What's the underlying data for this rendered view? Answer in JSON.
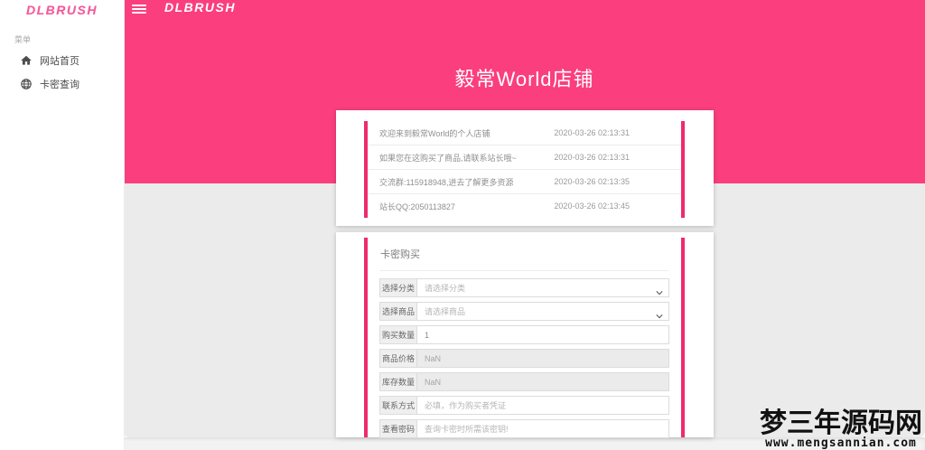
{
  "colors": {
    "accent_pink": "#fb3e7d",
    "border_pink": "#ee2b6e",
    "page_bg": "#ebebeb"
  },
  "sidebar": {
    "logo": "DLBRUSH",
    "menu_label": "菜单",
    "items": [
      {
        "label": "网站首页",
        "icon": "home-icon"
      },
      {
        "label": "卡密查询",
        "icon": "globe-icon"
      }
    ]
  },
  "header": {
    "logo": "DLBRUSH"
  },
  "banner": {
    "title": "毅常World店铺"
  },
  "announcements": {
    "rows": [
      {
        "text": "欢迎来到毅常World的个人店铺",
        "time": "2020-03-26 02:13:31"
      },
      {
        "text": "如果您在这购买了商品,请联系站长哦~",
        "time": "2020-03-26 02:13:31"
      },
      {
        "text": "交流群:115918948,进去了解更多资源",
        "time": "2020-03-26 02:13:35"
      },
      {
        "text": "站长QQ:2050113827",
        "time": "2020-03-26 02:13:45"
      }
    ]
  },
  "purchase": {
    "title": "卡密购买",
    "fields": [
      {
        "name": "category",
        "label": "选择分类",
        "type": "select",
        "value": "请选择分类"
      },
      {
        "name": "product",
        "label": "选择商品",
        "type": "select",
        "value": "请选择商品"
      },
      {
        "name": "quantity",
        "label": "购买数量",
        "type": "input",
        "value": "1"
      },
      {
        "name": "price",
        "label": "商品价格",
        "type": "input",
        "value": "NaN",
        "disabled": true
      },
      {
        "name": "stock",
        "label": "库存数量",
        "type": "input",
        "value": "NaN",
        "disabled": true
      },
      {
        "name": "contact",
        "label": "联系方式",
        "type": "input",
        "placeholder": "必填，作为购买者凭证"
      },
      {
        "name": "view-password",
        "label": "查看密码",
        "type": "input",
        "placeholder": "查询卡密时所需该密钥!"
      }
    ]
  },
  "watermark": {
    "line1": "梦三年源码网",
    "line2": "www.mengsannian.com"
  }
}
